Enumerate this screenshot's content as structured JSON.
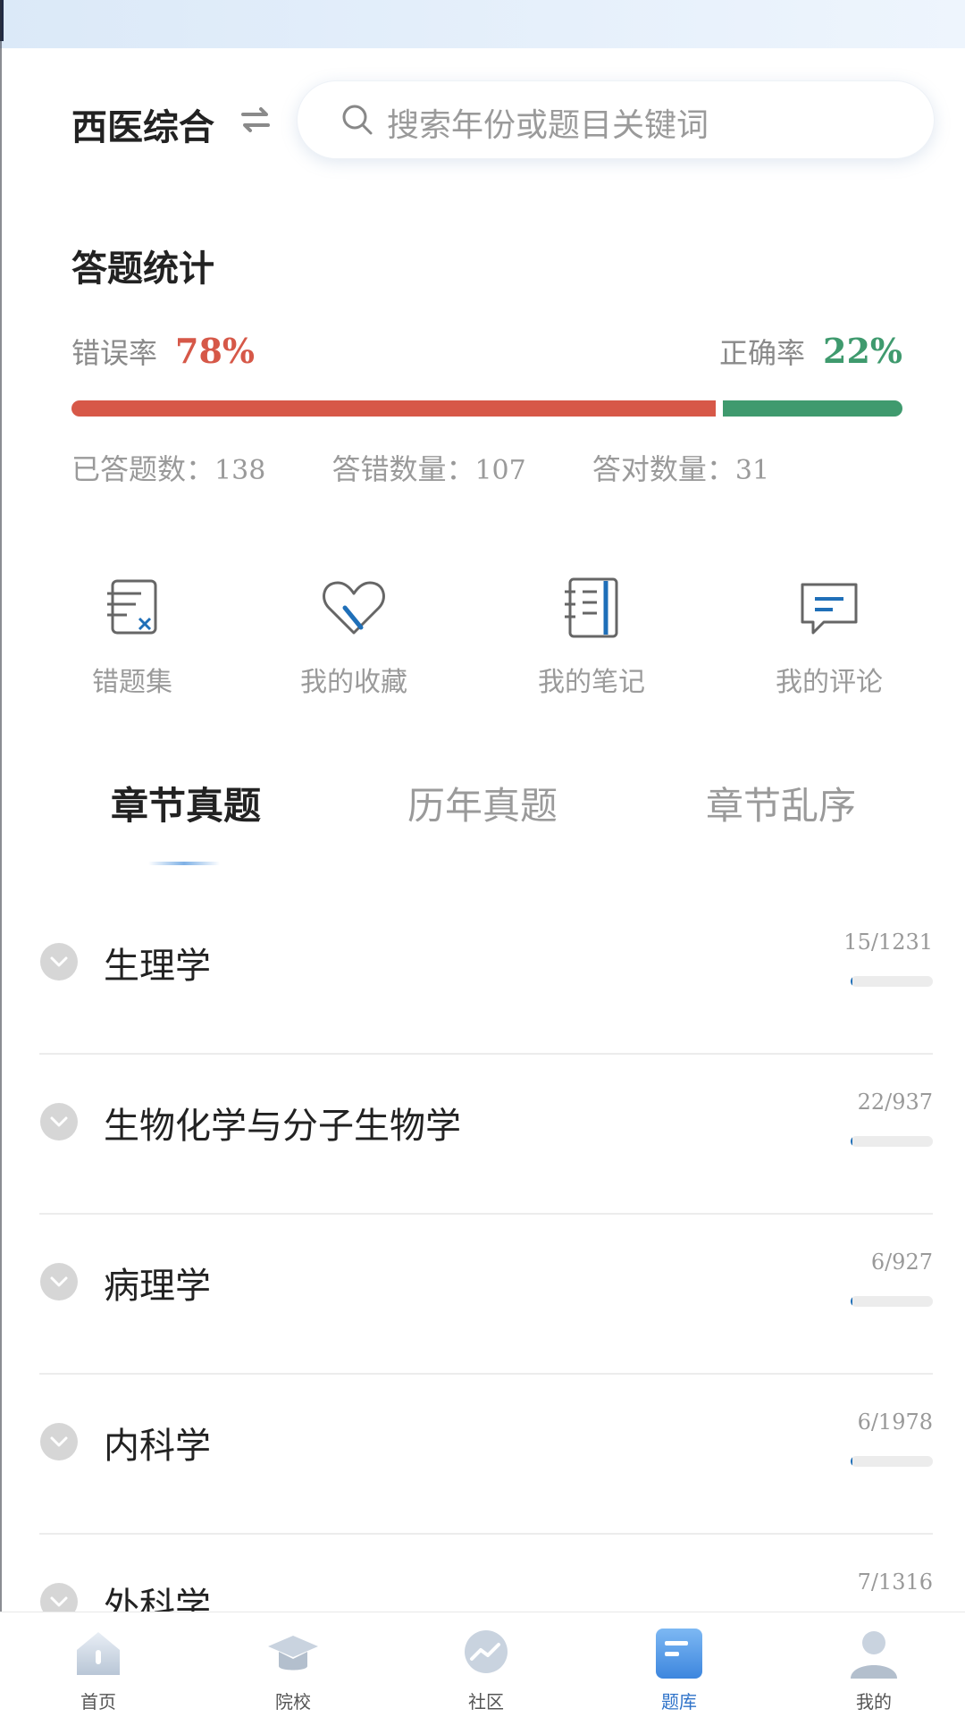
{
  "header": {
    "subject": "西医综合",
    "search_placeholder": "搜索年份或题目关键词"
  },
  "stats": {
    "title": "答题统计",
    "wrong_label": "错误率",
    "wrong_rate": "78%",
    "wrong_fraction": 0.78,
    "correct_label": "正确率",
    "correct_rate": "22%",
    "answered_label": "已答题数：",
    "answered_count": "138",
    "wrong_count_label": "答错数量：",
    "wrong_count": "107",
    "right_count_label": "答对数量：",
    "right_count": "31"
  },
  "quick_actions": [
    {
      "label": "错题集",
      "icon": "wrong-questions-icon"
    },
    {
      "label": "我的收藏",
      "icon": "favorite-icon"
    },
    {
      "label": "我的笔记",
      "icon": "notebook-icon"
    },
    {
      "label": "我的评论",
      "icon": "comment-icon"
    }
  ],
  "tabs": [
    {
      "label": "章节真题",
      "active": true
    },
    {
      "label": "历年真题",
      "active": false
    },
    {
      "label": "章节乱序",
      "active": false
    }
  ],
  "chapters": [
    {
      "name": "生理学",
      "count": "15/1231",
      "progress": 0.012
    },
    {
      "name": "生物化学与分子生物学",
      "count": "22/937",
      "progress": 0.023
    },
    {
      "name": "病理学",
      "count": "6/927",
      "progress": 0.006
    },
    {
      "name": "内科学",
      "count": "6/1978",
      "progress": 0.003
    },
    {
      "name": "外科学",
      "count": "7/1316",
      "progress": 0.005
    }
  ],
  "bottom_nav": [
    {
      "label": "首页",
      "icon": "home-icon",
      "active": false
    },
    {
      "label": "院校",
      "icon": "graduation-cap-icon",
      "active": false
    },
    {
      "label": "社区",
      "icon": "community-icon",
      "active": false
    },
    {
      "label": "题库",
      "icon": "question-bank-icon",
      "active": true
    },
    {
      "label": "我的",
      "icon": "profile-icon",
      "active": false
    }
  ],
  "colors": {
    "wrong": "#d75848",
    "correct": "#3f9a6e",
    "accent": "#2f73c9"
  }
}
